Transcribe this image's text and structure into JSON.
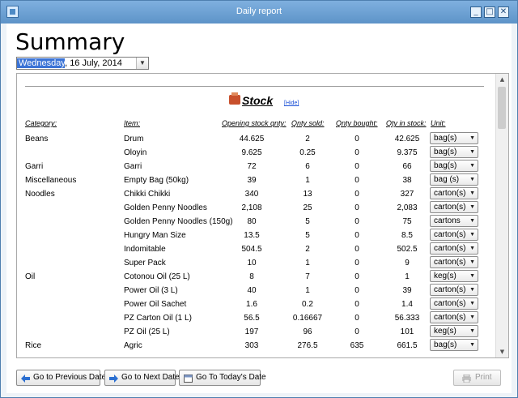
{
  "window": {
    "title": "Daily report",
    "buttons": [
      "_",
      "□",
      "✕"
    ]
  },
  "page_title": "Summary",
  "date_picker": {
    "selected_part": "Wednesday",
    "rest": ", 16 July, 2014"
  },
  "report": {
    "section_title": "Stock",
    "hide_link": "[Hide]",
    "columns": [
      "Category:",
      "Item:",
      "Opening stock qnty:",
      "Qnty sold:",
      "Qnty bought:",
      "Qty in stock:",
      "Unit:"
    ],
    "rows": [
      {
        "category": "Beans",
        "item": "Drum",
        "opening": "44.625",
        "sold": "2",
        "bought": "0",
        "stock": "42.625",
        "unit": "bag(s)"
      },
      {
        "category": "",
        "item": "Oloyin",
        "opening": "9.625",
        "sold": "0.25",
        "bought": "0",
        "stock": "9.375",
        "unit": "bag(s)"
      },
      {
        "category": "Garri",
        "item": "Garri",
        "opening": "72",
        "sold": "6",
        "bought": "0",
        "stock": "66",
        "unit": "bag(s)"
      },
      {
        "category": "Miscellaneous",
        "item": "Empty Bag (50kg)",
        "opening": "39",
        "sold": "1",
        "bought": "0",
        "stock": "38",
        "unit": "bag (s)"
      },
      {
        "category": "Noodles",
        "item": "Chikki Chikki",
        "opening": "340",
        "sold": "13",
        "bought": "0",
        "stock": "327",
        "unit": "carton(s)"
      },
      {
        "category": "",
        "item": "Golden Penny Noodles",
        "opening": "2,108",
        "sold": "25",
        "bought": "0",
        "stock": "2,083",
        "unit": "carton(s)"
      },
      {
        "category": "",
        "item": "Golden Penny Noodles (150g)",
        "opening": "80",
        "sold": "5",
        "bought": "0",
        "stock": "75",
        "unit": "cartons"
      },
      {
        "category": "",
        "item": "Hungry Man Size",
        "opening": "13.5",
        "sold": "5",
        "bought": "0",
        "stock": "8.5",
        "unit": "carton(s)"
      },
      {
        "category": "",
        "item": "Indomitable",
        "opening": "504.5",
        "sold": "2",
        "bought": "0",
        "stock": "502.5",
        "unit": "carton(s)"
      },
      {
        "category": "",
        "item": "Super Pack",
        "opening": "10",
        "sold": "1",
        "bought": "0",
        "stock": "9",
        "unit": "carton(s)"
      },
      {
        "category": "Oil",
        "item": "Cotonou Oil (25 L)",
        "opening": "8",
        "sold": "7",
        "bought": "0",
        "stock": "1",
        "unit": "keg(s)"
      },
      {
        "category": "",
        "item": "Power Oil (3 L)",
        "opening": "40",
        "sold": "1",
        "bought": "0",
        "stock": "39",
        "unit": "carton(s)"
      },
      {
        "category": "",
        "item": "Power Oil Sachet",
        "opening": "1.6",
        "sold": "0.2",
        "bought": "0",
        "stock": "1.4",
        "unit": "carton(s)"
      },
      {
        "category": "",
        "item": "PZ Carton Oil (1 L)",
        "opening": "56.5",
        "sold": "0.16667",
        "bought": "0",
        "stock": "56.333",
        "unit": "carton(s)"
      },
      {
        "category": "",
        "item": "PZ Oil (25 L)",
        "opening": "197",
        "sold": "96",
        "bought": "0",
        "stock": "101",
        "unit": "keg(s)"
      },
      {
        "category": "Rice",
        "item": "Agric",
        "opening": "303",
        "sold": "276.5",
        "bought": "635",
        "stock": "661.5",
        "unit": "bag(s)"
      }
    ]
  },
  "footer": {
    "prev": "Go to Previous Date",
    "next": "Go to Next Date",
    "today": "Go To Today's Date",
    "print": "Print"
  }
}
